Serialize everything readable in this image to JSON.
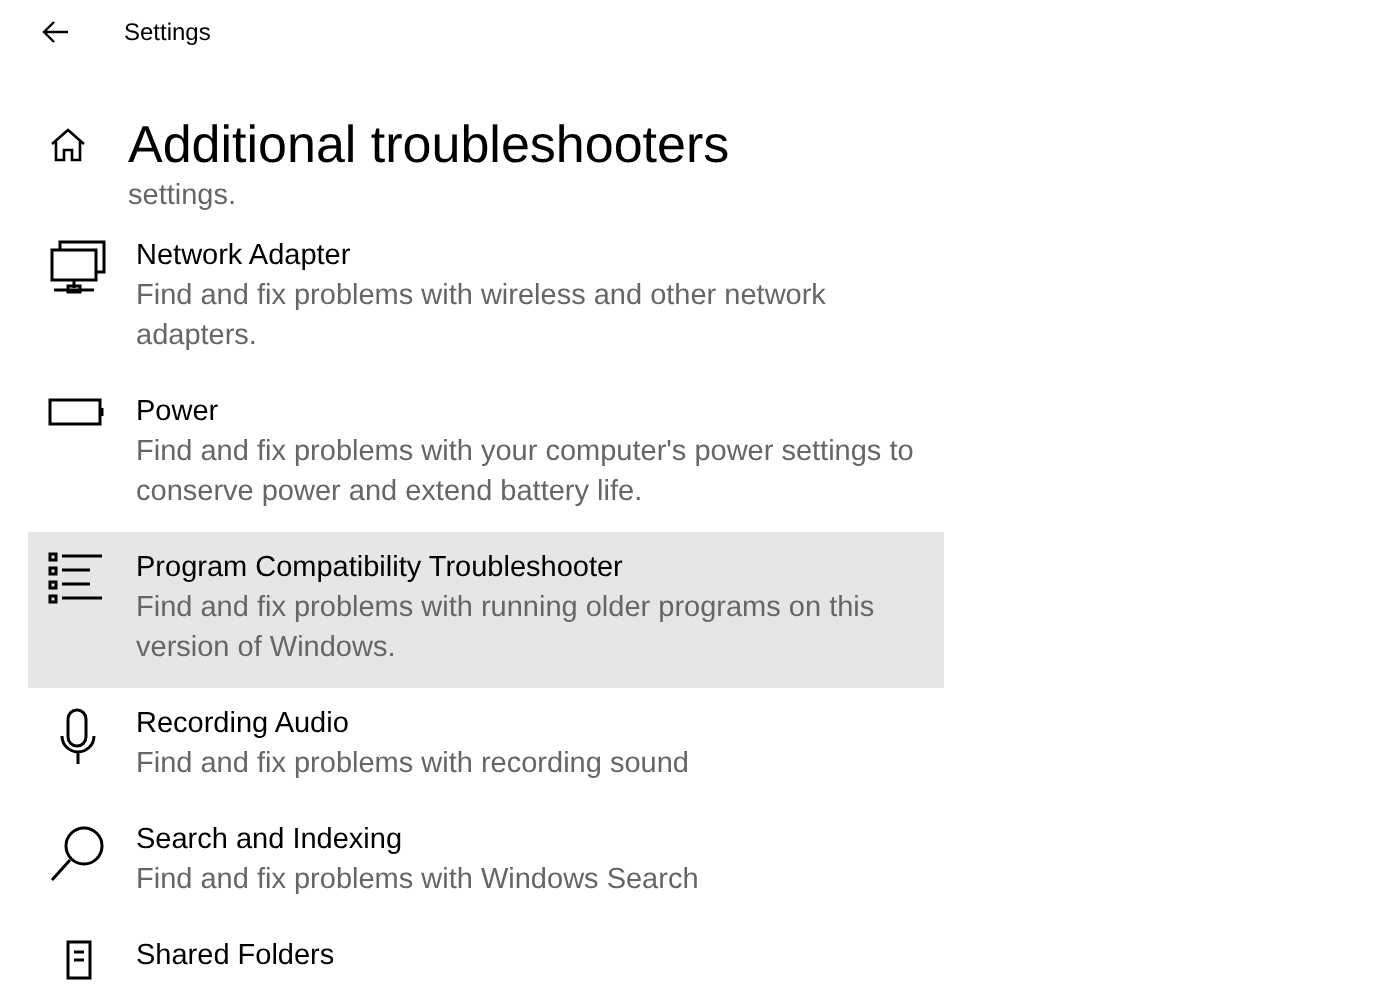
{
  "header": {
    "title": "Settings"
  },
  "page": {
    "title": "Additional troubleshooters"
  },
  "previous_item_tail": "settings.",
  "items": [
    {
      "title": "Network Adapter",
      "description": "Find and fix problems with wireless and other network adapters.",
      "selected": false
    },
    {
      "title": "Power",
      "description": "Find and fix problems with your computer's power settings to conserve power and extend battery life.",
      "selected": false
    },
    {
      "title": "Program Compatibility Troubleshooter",
      "description": "Find and fix problems with running older programs on this version of Windows.",
      "selected": true
    },
    {
      "title": "Recording Audio",
      "description": "Find and fix problems with recording sound",
      "selected": false
    },
    {
      "title": "Search and Indexing",
      "description": "Find and fix problems with Windows Search",
      "selected": false
    },
    {
      "title": "Shared Folders",
      "selected": false
    }
  ]
}
